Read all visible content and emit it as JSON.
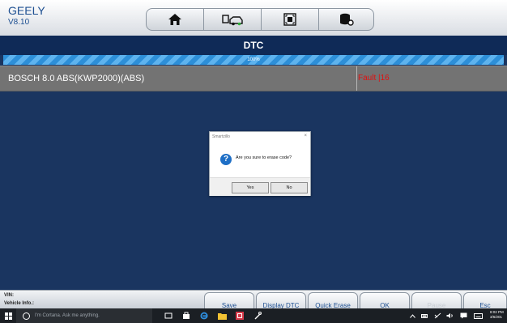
{
  "app": {
    "brand": "GEELY",
    "version": "V8.10",
    "title": "DTC",
    "progress": {
      "percent": 100,
      "label": "100%"
    },
    "row": {
      "system": "BOSCH 8.0 ABS(KWP2000)(ABS)",
      "status": "Fault |16"
    },
    "toolbar": {
      "icons": [
        "home-icon",
        "car-connect-icon",
        "screenshot-icon",
        "database-settings-icon"
      ]
    }
  },
  "dialog": {
    "title": "Smartzillo",
    "close": "×",
    "message": "Are you sure to erase code?",
    "yes": "Yes",
    "no": "No",
    "icon": "?"
  },
  "bottom": {
    "vin": "VIN:",
    "vehicle_info": "Vehicle Info.:",
    "buttons": [
      "Save",
      "Display DTC",
      "Quick Erase",
      "OK",
      "Pause",
      "Esc"
    ]
  },
  "taskbar": {
    "search_placeholder": "I'm Cortana. Ask me anything.",
    "time": "8:02 PM",
    "date": "3/6/201"
  },
  "colors": {
    "fault": "#e01010",
    "accent": "#1d4f91",
    "background": "#1a3560"
  }
}
